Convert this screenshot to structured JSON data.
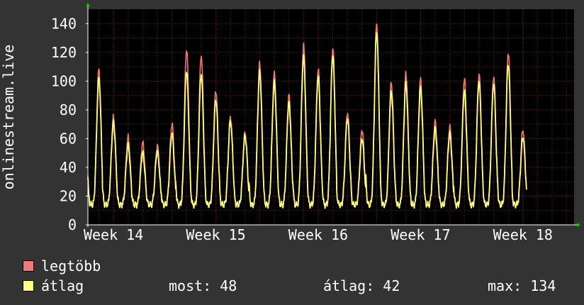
{
  "chart_data": {
    "type": "line",
    "title": "",
    "ylabel": "onlinestream.live",
    "xlabel": "",
    "x_ticks": [
      "Week 14",
      "Week 15",
      "Week 16",
      "Week 17",
      "Week 18"
    ],
    "y_ticks": [
      0,
      20,
      40,
      60,
      80,
      100,
      120,
      140
    ],
    "ylim": [
      0,
      150
    ],
    "x_range_weeks": [
      13.75,
      18.5
    ],
    "grid": true,
    "series": [
      {
        "name": "legtöbb",
        "color": "#f07a7a",
        "daily_peaks": [
          108,
          75,
          61,
          57,
          55,
          70,
          122,
          118,
          93,
          75,
          64,
          112,
          105,
          90,
          125,
          108,
          123,
          78,
          66,
          140,
          99,
          105,
          101,
          72,
          68,
          101,
          105,
          103,
          120,
          66
        ]
      },
      {
        "name": "átlag",
        "color": "#ffff80",
        "daily_peaks": [
          102,
          71,
          55,
          50,
          51,
          63,
          107,
          105,
          87,
          72,
          62,
          106,
          99,
          85,
          117,
          103,
          118,
          74,
          60,
          134,
          93,
          98,
          95,
          67,
          63,
          93,
          100,
          98,
          112,
          61
        ]
      }
    ],
    "trough_value": 14
  },
  "legend": {
    "items": [
      {
        "label": "legtöbb",
        "color": "#f07a7a"
      },
      {
        "label": "átlag",
        "color": "#ffff80"
      }
    ]
  },
  "stats": {
    "most": "most: 48",
    "atlag": "átlag: 42",
    "max": "max: 134"
  },
  "colors": {
    "background": "#333333",
    "plot_area": "#000000",
    "grid": "#5a2a2a",
    "axis": "#ffffff",
    "arrow": "#00cc00"
  }
}
